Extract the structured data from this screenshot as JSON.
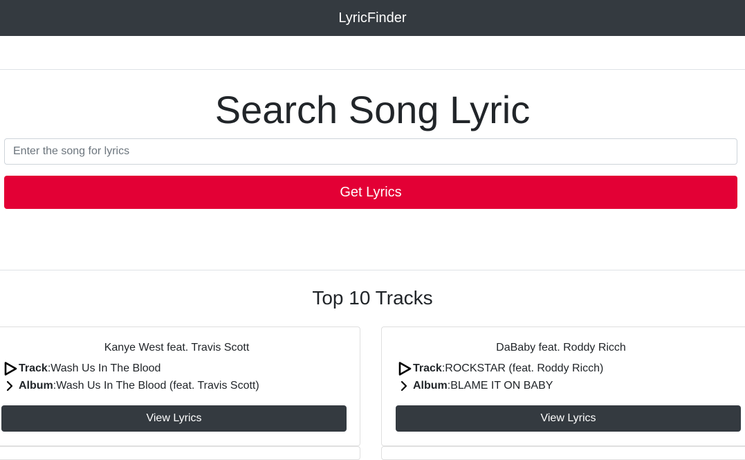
{
  "navbar": {
    "brand": "LyricFinder"
  },
  "hero": {
    "title": "Search Song Lyric",
    "search_placeholder": "Enter the song for lyrics",
    "search_value": "",
    "button_label": "Get Lyrics"
  },
  "section": {
    "title": "Top 10 Tracks"
  },
  "tracks": [
    {
      "artist": "Kanye West feat. Travis Scott",
      "track_label": "Track",
      "track": "Wash Us In The Blood",
      "album_label": "Album",
      "album": "Wash Us In The Blood (feat. Travis Scott)",
      "button_label": "View Lyrics"
    },
    {
      "artist": "DaBaby feat. Roddy Ricch",
      "track_label": "Track",
      "track": "ROCKSTAR (feat. Roddy Ricch)",
      "album_label": "Album",
      "album": "BLAME IT ON BABY",
      "button_label": "View Lyrics"
    }
  ],
  "colors": {
    "navbar_bg": "#343a40",
    "accent_red": "#e30035",
    "button_dark": "#343a40"
  },
  "icons": {
    "track": "play-icon",
    "album": "chevron-right-icon"
  }
}
